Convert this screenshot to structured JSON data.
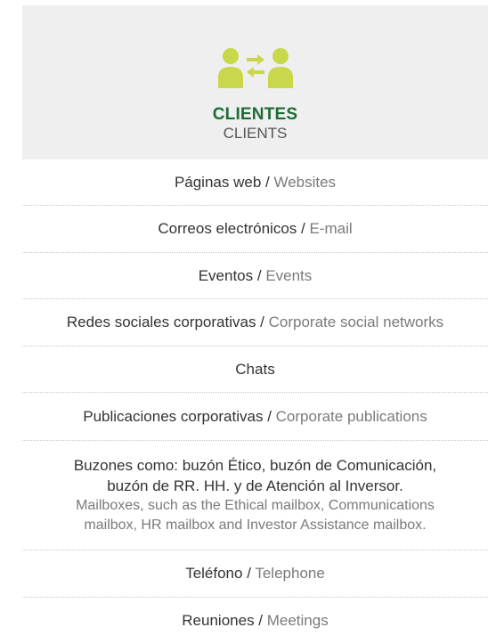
{
  "header": {
    "icon": "people-exchange-icon",
    "icon_color": "#c9d84a",
    "title_es": "CLIENTES",
    "title_en": "CLIENTS",
    "title_color": "#1f6b35"
  },
  "separator": " / ",
  "items": [
    {
      "es": "Páginas web",
      "en": "Websites"
    },
    {
      "es": "Correos electrónicos",
      "en": "E-mail"
    },
    {
      "es": "Eventos ",
      "en": "Events"
    },
    {
      "es": "Redes sociales corporativas",
      "en": "Corporate social networks"
    },
    {
      "es": "Chats"
    },
    {
      "es": "Publicaciones corporativas",
      "en": "Corporate publications"
    },
    {
      "es_lines": [
        "Buzones como: buzón Ético, buzón de Comunicación,",
        "buzón de RR. HH. y de Atención al Inversor."
      ],
      "en_lines": [
        "Mailboxes, such as the Ethical mailbox, Communications",
        "mailbox, HR mailbox and Investor Assistance mailbox."
      ]
    },
    {
      "es": "Teléfono",
      "en": "Telephone"
    },
    {
      "es": "Reuniones",
      "en": "Meetings"
    }
  ]
}
